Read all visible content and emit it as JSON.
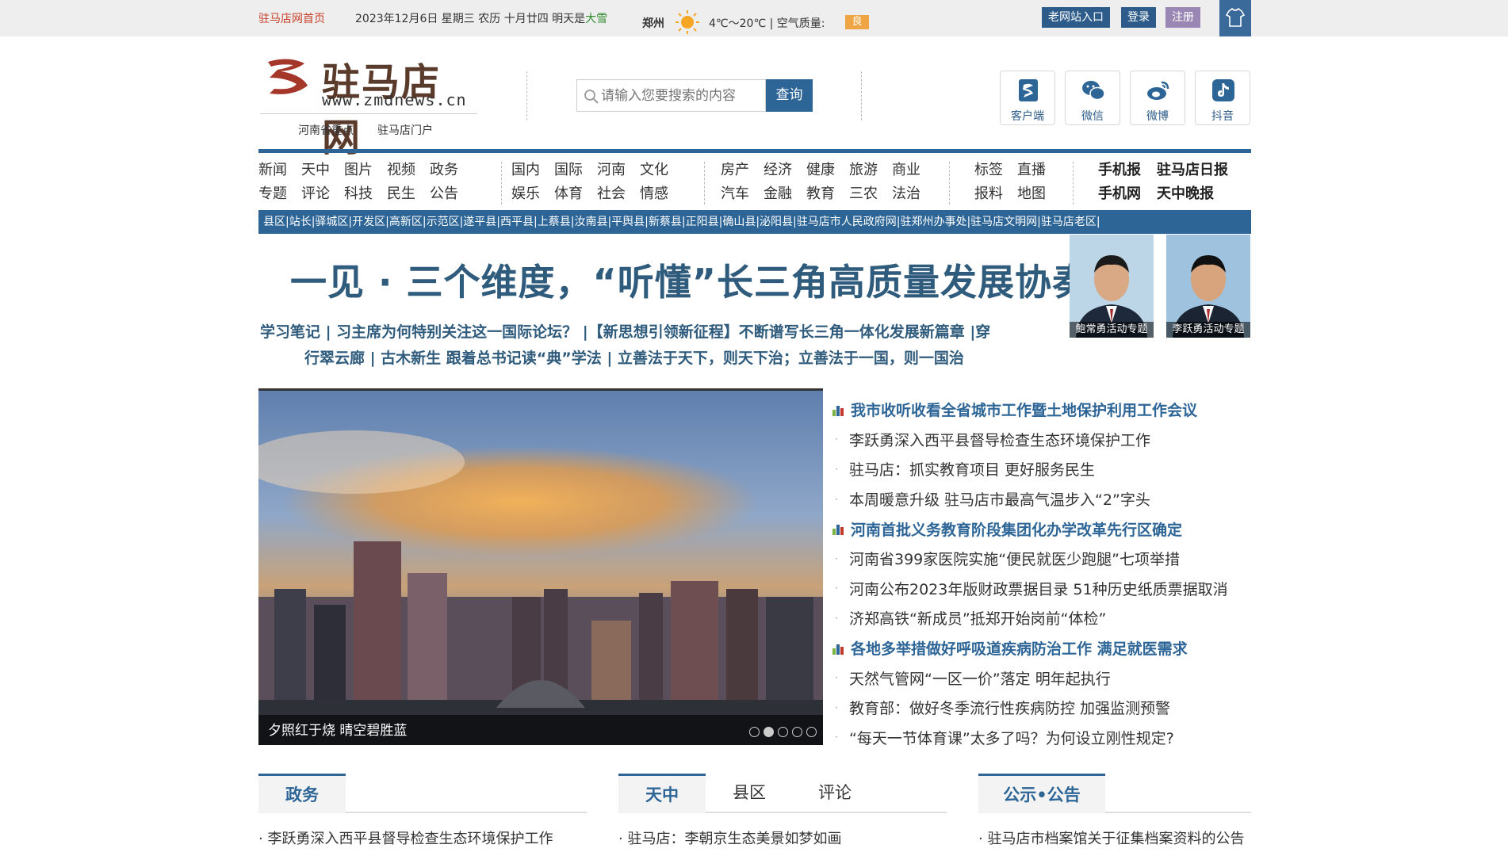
{
  "topbar": {
    "home": "驻马店网首页",
    "date": "2023年12月6日 星期三 农历 十月廿四 明天是",
    "weather_word": "大雪",
    "city": "郑州",
    "temp": "4℃～20℃ | 空气质量:",
    "aq": "良",
    "old_site": "老网站入口",
    "login": "登录",
    "register": "注册"
  },
  "header": {
    "logo_text": "驻马店网",
    "logo_url": "www.zmdnews.cn",
    "slogan1": "河南省重点",
    "slogan2": "驻马店门户",
    "search_placeholder": "请输入您要搜索的内容",
    "search_button": "查询",
    "apps": [
      "客户端",
      "微信",
      "微博",
      "抖音"
    ]
  },
  "nav": {
    "g1r1": [
      "新闻",
      "天中",
      "图片",
      "视频",
      "政务"
    ],
    "g1r2": [
      "专题",
      "评论",
      "科技",
      "民生",
      "公告"
    ],
    "g2r1": [
      "国内",
      "国际",
      "河南",
      "文化"
    ],
    "g2r2": [
      "娱乐",
      "体育",
      "社会",
      "情感"
    ],
    "g3r1": [
      "房产",
      "经济",
      "健康",
      "旅游",
      "商业"
    ],
    "g3r2": [
      "汽车",
      "金融",
      "教育",
      "三农",
      "法治"
    ],
    "g4r1": [
      "标签",
      "直播"
    ],
    "g4r2": [
      "报料",
      "地图"
    ],
    "g5r1": [
      "手机报",
      "驻马店日报"
    ],
    "g5r2": [
      "手机网",
      "天中晚报"
    ]
  },
  "county_bar": "县区|站长|驿城区|开发区|高新区|示范区|遂平县|西平县|上蔡县|汝南县|平舆县|新蔡县|正阳县|确山县|泌阳县|驻马店市人民政府网|驻郑州办事处|驻马店文明网|驻马店老区|",
  "headline": {
    "big": "一见 · 三个维度，“听懂”长三角高质量发展协奏曲",
    "sub1": "学习笔记 | 习主席为何特别关注这一国际论坛？ |【新思想引领新征程】不断谱写长三角一体化发展新篇章 |穿",
    "sub2": "行翠云廊 | 古木新生   跟着总书记读“典”学法 | 立善法于天下，则天下治；立善法于一国，则一国治"
  },
  "leaders": [
    "鲍常勇活动专题",
    "李跃勇活动专题"
  ],
  "slide": {
    "caption": "夕照红于烧 晴空碧胜蓝",
    "active_dot": 2,
    "dot_count": 5
  },
  "news": [
    {
      "text": "我市收听收看全省城市工作暨土地保护利用工作会议",
      "lead": true
    },
    {
      "text": "李跃勇深入西平县督导检查生态环境保护工作",
      "lead": false
    },
    {
      "text": "驻马店：抓实教育项目 更好服务民生",
      "lead": false
    },
    {
      "text": "本周暖意升级 驻马店市最高气温步入“2”字头",
      "lead": false
    },
    {
      "text": "河南首批义务教育阶段集团化办学改革先行区确定",
      "lead": true
    },
    {
      "text": "河南省399家医院实施“便民就医少跑腿”七项举措",
      "lead": false
    },
    {
      "text": "河南公布2023年版财政票据目录 51种历史纸质票据取消",
      "lead": false
    },
    {
      "text": "济郑高铁“新成员”抵郑开始岗前“体检”",
      "lead": false
    },
    {
      "text": "各地多举措做好呼吸道疾病防治工作 满足就医需求",
      "lead": true
    },
    {
      "text": "天然气管网“一区一价”落定 明年起执行",
      "lead": false
    },
    {
      "text": "教育部：做好冬季流行性疾病防控 加强监测预警",
      "lead": false
    },
    {
      "text": "“每天一节体育课”太多了吗？为何设立刚性规定?",
      "lead": false
    }
  ],
  "sections": {
    "s1": {
      "tab": "政务",
      "item": "李跃勇深入西平县督导检查生态环境保护工作"
    },
    "s2": {
      "tabs": [
        "天中",
        "县区",
        "评论"
      ],
      "item": "驻马店：李朝京生态美景如梦如画"
    },
    "s3": {
      "tab": "公示•公告",
      "item": "驻马店市档案馆关于征集档案资料的公告"
    }
  },
  "colors": {
    "primary": "#2d6597",
    "headline": "#2f5b7c",
    "accent_red": "#c8402a",
    "aq_badge": "#f0a544"
  }
}
